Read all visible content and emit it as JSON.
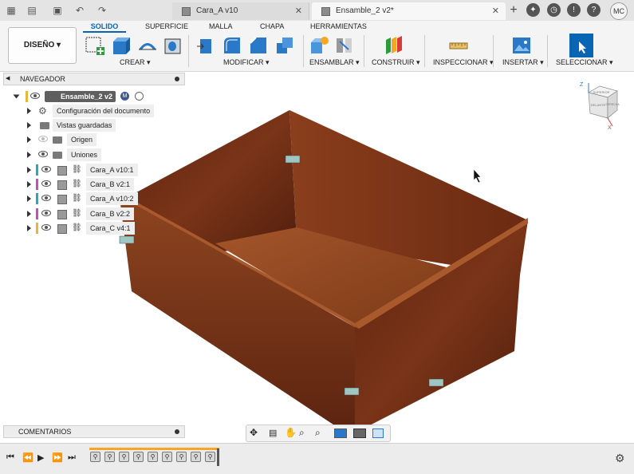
{
  "titlebar": {
    "tabs": [
      {
        "label": "Cara_A v10",
        "active": false
      },
      {
        "label": "Ensamble_2 v2*",
        "active": true
      }
    ],
    "icons": [
      "grid-apps-icon",
      "file-icon",
      "save-icon",
      "undo-icon",
      "redo-icon",
      "new-tab-icon",
      "extensions-icon",
      "job-status-icon",
      "notifications-icon",
      "help-icon"
    ],
    "user_initials": "MC"
  },
  "toolbar": {
    "workspace_label": "DISEÑO ▾",
    "tabs": [
      "SOLIDO",
      "SUPERFICIE",
      "MALLA",
      "CHAPA",
      "HERRAMIENTAS"
    ],
    "active_tab": "SOLIDO",
    "groups": [
      "CREAR ▾",
      "MODIFICAR ▾",
      "ENSAMBLAR ▾",
      "CONSTRUIR ▾",
      "INSPECCIONAR ▾",
      "INSERTAR ▾",
      "SELECCIONAR ▾"
    ]
  },
  "browser": {
    "title": "NAVEGADOR",
    "root": "Ensamble_2 v2",
    "items": [
      {
        "label": "Configuración del documento",
        "icon": "gear-icon"
      },
      {
        "label": "Vistas guardadas",
        "icon": "folder-icon"
      },
      {
        "label": "Origen",
        "icon": "folder-icon"
      },
      {
        "label": "Uniones",
        "icon": "folder-icon"
      },
      {
        "label": "Cara_A v10:1",
        "icon": "link-icon",
        "color": "#2aa8b8"
      },
      {
        "label": "Cara_B v2:1",
        "icon": "link-icon",
        "color": "#c44fb8"
      },
      {
        "label": "Cara_A v10:2",
        "icon": "link-icon",
        "color": "#2aa8b8"
      },
      {
        "label": "Cara_B v2:2",
        "icon": "link-icon",
        "color": "#c44fb8"
      },
      {
        "label": "Cara_C v4:1",
        "icon": "link-icon",
        "color": "#e9b43a"
      }
    ]
  },
  "comments": {
    "title": "COMENTARIOS"
  },
  "viewcube": {
    "labels": [
      "SUPERIOR",
      "DELANTE",
      "DERECHA"
    ],
    "axes": [
      "Z",
      "X"
    ]
  },
  "timeline": {
    "controls": [
      "first-icon",
      "previous-icon",
      "play-icon",
      "next-icon",
      "last-icon"
    ],
    "item_count": 9
  },
  "colors": {
    "accent": "#0a64b4",
    "wood": "#7a3518",
    "timeline_progress": "#f5a623"
  }
}
